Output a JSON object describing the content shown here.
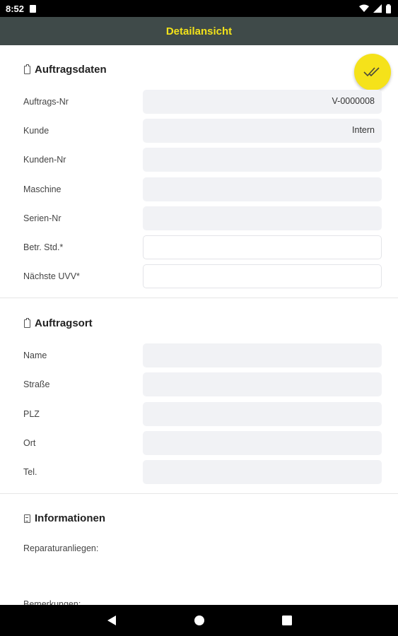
{
  "status_bar": {
    "time": "8:52"
  },
  "app_bar": {
    "title": "Detailansicht"
  },
  "section_order": {
    "title": "Auftragsdaten",
    "fields": [
      {
        "label": "Auftrags-Nr",
        "value": "V-0000008"
      },
      {
        "label": "Kunde",
        "value": "Intern"
      },
      {
        "label": "Kunden-Nr",
        "value": ""
      },
      {
        "label": "Maschine",
        "value": ""
      },
      {
        "label": "Serien-Nr",
        "value": ""
      },
      {
        "label": "Betr. Std.*",
        "value": ""
      },
      {
        "label": "Nächste UVV*",
        "value": ""
      }
    ]
  },
  "section_location": {
    "title": "Auftragsort",
    "fields": [
      {
        "label": "Name",
        "value": ""
      },
      {
        "label": "Straße",
        "value": ""
      },
      {
        "label": "PLZ",
        "value": ""
      },
      {
        "label": "Ort",
        "value": ""
      },
      {
        "label": "Tel.",
        "value": ""
      }
    ]
  },
  "section_info": {
    "title": "Informationen",
    "repair_label": "Reparaturanliegen:",
    "remarks_label": "Bemerkungen:"
  },
  "colors": {
    "app_bar": "#3f4a49",
    "accent": "#f5e21a",
    "title_text": "#f2e21a"
  }
}
